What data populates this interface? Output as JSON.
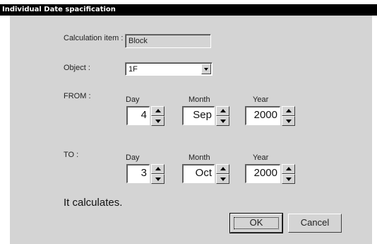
{
  "window": {
    "title": "Individual Date spacification"
  },
  "calc_item": {
    "label": "Calculation item :",
    "value": "Block"
  },
  "object": {
    "label": "Object :",
    "value": "1F"
  },
  "from": {
    "label": "FROM :",
    "day_label": "Day",
    "month_label": "Month",
    "year_label": "Year",
    "day": "4",
    "month": "Sep",
    "year": "2000"
  },
  "to": {
    "label": "TO :",
    "day_label": "Day",
    "month_label": "Month",
    "year_label": "Year",
    "day": "3",
    "month": "Oct",
    "year": "2000"
  },
  "status": "It calculates.",
  "buttons": {
    "ok": "OK",
    "cancel": "Cancel"
  }
}
